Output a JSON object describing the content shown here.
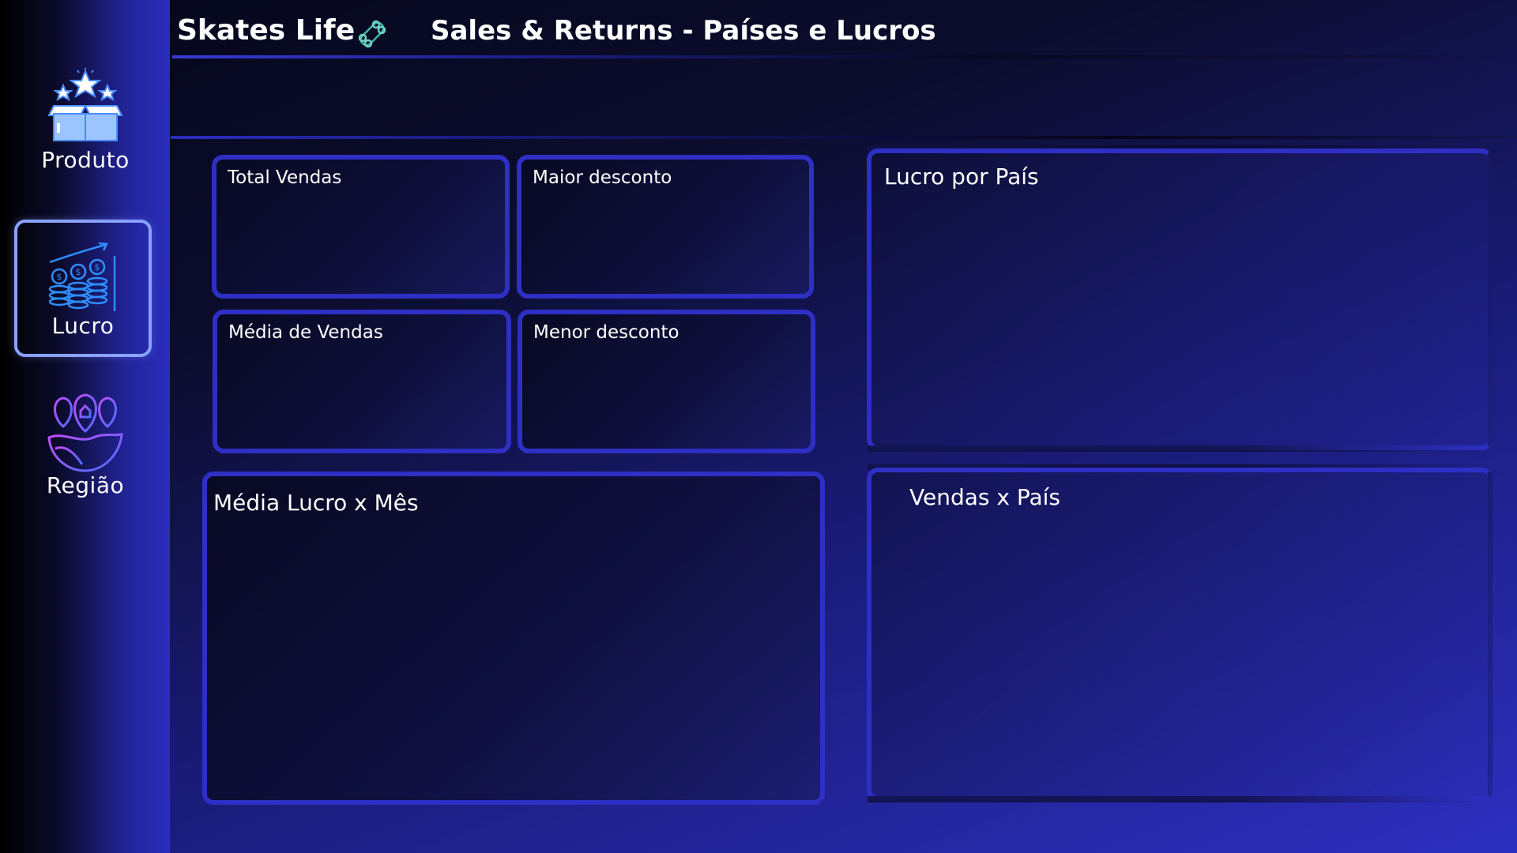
{
  "header": {
    "app_title": "Skates Life",
    "page_title": "Sales & Returns - Países e Lucros"
  },
  "sidebar": {
    "items": [
      {
        "label": "Produto",
        "icon": "box-stars-icon",
        "selected": false
      },
      {
        "label": "Lucro",
        "icon": "coins-growth-icon",
        "selected": true
      },
      {
        "label": "Região",
        "icon": "map-pins-icon",
        "selected": false
      }
    ]
  },
  "cards": {
    "total_vendas": "Total Vendas",
    "maior_desconto": "Maior desconto",
    "media_vendas": "Média de Vendas",
    "menor_desconto": "Menor desconto",
    "media_lucro_mes": "Média Lucro x Mês",
    "lucro_pais": "Lucro por País",
    "vendas_pais": "Vendas x País"
  },
  "colors": {
    "accent_border": "#2e2fc4",
    "selected_border": "#8aa2ff",
    "icon_blue": "#4a8cff",
    "icon_purple": "#a64dff"
  }
}
